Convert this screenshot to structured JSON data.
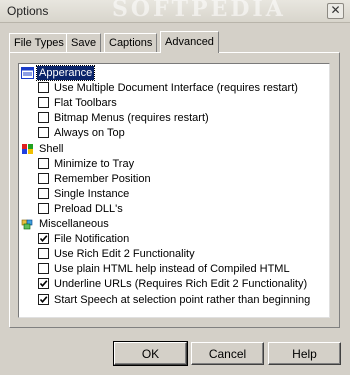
{
  "window": {
    "title": "Options",
    "watermark": "SOFTPEDIA",
    "close_glyph": "✕"
  },
  "tabs": [
    {
      "label": "File Types",
      "active": false
    },
    {
      "label": "Save",
      "active": false
    },
    {
      "label": "Captions",
      "active": false
    },
    {
      "label": "Advanced",
      "active": true
    }
  ],
  "groups": [
    {
      "label": "Apperance",
      "icon": "window-icon",
      "selected": true,
      "options": [
        {
          "label": "Use Multiple Document Interface (requires restart)",
          "checked": false
        },
        {
          "label": "Flat Toolbars",
          "checked": false
        },
        {
          "label": "Bitmap Menus (requires restart)",
          "checked": false
        },
        {
          "label": "Always on Top",
          "checked": false
        }
      ]
    },
    {
      "label": "Shell",
      "icon": "windows-flag-icon",
      "selected": false,
      "options": [
        {
          "label": "Minimize to Tray",
          "checked": false
        },
        {
          "label": "Remember Position",
          "checked": false
        },
        {
          "label": "Single Instance",
          "checked": false
        },
        {
          "label": "Preload DLL's",
          "checked": false
        }
      ]
    },
    {
      "label": "Miscellaneous",
      "icon": "puzzle-icon",
      "selected": false,
      "options": [
        {
          "label": "File Notification",
          "checked": true
        },
        {
          "label": "Use Rich Edit 2 Functionality",
          "checked": false
        },
        {
          "label": "Use plain HTML help instead of Compiled HTML",
          "checked": false
        },
        {
          "label": "Underline URLs (Requires Rich Edit 2 Functionality)",
          "checked": true
        },
        {
          "label": "Start Speech at selection point rather than beginning",
          "checked": true
        }
      ]
    }
  ],
  "buttons": {
    "ok": "OK",
    "cancel": "Cancel",
    "help": "Help"
  }
}
